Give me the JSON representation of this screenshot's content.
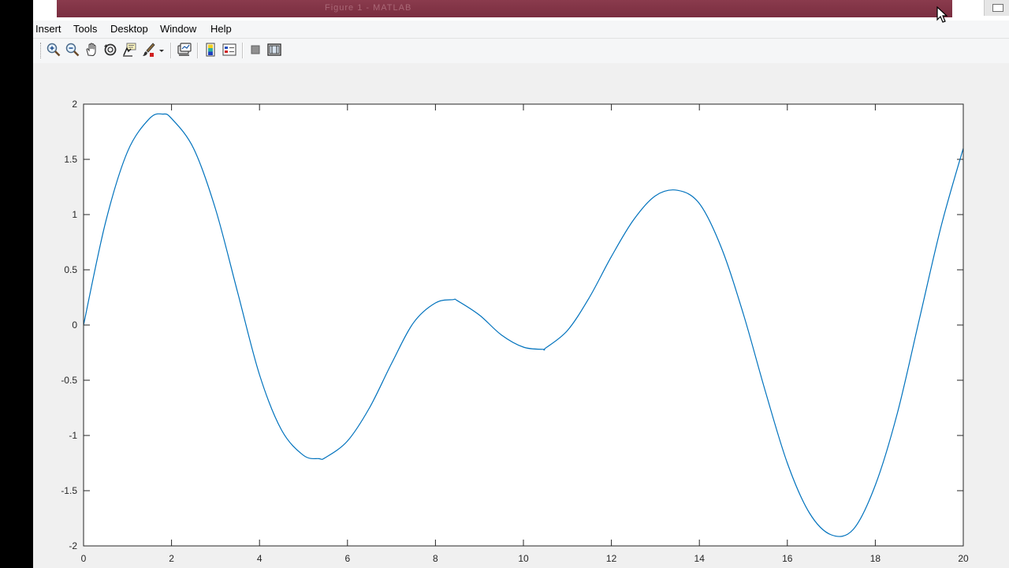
{
  "window": {
    "title": "Figure 1 - MATLAB"
  },
  "menu": {
    "items": [
      {
        "label": "Insert"
      },
      {
        "label": "Tools"
      },
      {
        "label": "Desktop"
      },
      {
        "label": "Window"
      },
      {
        "label": "Help"
      }
    ]
  },
  "toolbar": {
    "icons": [
      "zoom-in-icon",
      "zoom-out-icon",
      "pan-hand-icon",
      "rotate-3d-icon",
      "data-cursor-icon",
      "brush-icon",
      "brush-dropdown-icon",
      "link-plot-icon",
      "colorbar-icon",
      "legend-icon",
      "hide-plot-tools-icon",
      "show-plot-tools-icon"
    ]
  },
  "colors": {
    "line": "#0072bd",
    "titlebar": "#7f3346",
    "figure_bg": "#f0f0f0",
    "axes_bg": "#ffffff"
  },
  "chart_data": {
    "type": "line",
    "title": "",
    "xlabel": "",
    "ylabel": "",
    "xlim": [
      0,
      20
    ],
    "ylim": [
      -2,
      2
    ],
    "xticks": [
      0,
      2,
      4,
      6,
      8,
      10,
      12,
      14,
      16,
      18,
      20
    ],
    "yticks": [
      -2,
      -1.5,
      -1,
      -0.5,
      0,
      0.5,
      1,
      1.5,
      2
    ],
    "xtick_labels": [
      "0",
      "2",
      "4",
      "6",
      "8",
      "10",
      "12",
      "14",
      "16",
      "18",
      "20"
    ],
    "ytick_labels": [
      "-2",
      "-1.5",
      "-1",
      "-0.5",
      "0",
      "0.5",
      "1",
      "1.5",
      "2"
    ],
    "grid": false,
    "series": [
      {
        "x": [
          0,
          0.5,
          1,
          1.5,
          1.8,
          2,
          2.5,
          3,
          3.5,
          4,
          4.5,
          5,
          5.35,
          5.5,
          6,
          6.5,
          7,
          7.5,
          8,
          8.4,
          8.5,
          9,
          9.5,
          10,
          10.45,
          10.5,
          11,
          11.5,
          12,
          12.5,
          13,
          13.5,
          14,
          14.5,
          15,
          15.5,
          16,
          16.5,
          17,
          17.5,
          18,
          18.5,
          19,
          19.5,
          20
        ],
        "y": [
          0,
          0.93,
          1.57,
          1.87,
          1.91,
          1.87,
          1.6,
          1.05,
          0.3,
          -0.45,
          -0.95,
          -1.18,
          -1.21,
          -1.2,
          -1.05,
          -0.75,
          -0.35,
          0.02,
          0.2,
          0.23,
          0.22,
          0.09,
          -0.09,
          -0.2,
          -0.22,
          -0.21,
          -0.05,
          0.25,
          0.62,
          0.95,
          1.17,
          1.22,
          1.1,
          0.7,
          0.1,
          -0.6,
          -1.25,
          -1.7,
          -1.9,
          -1.85,
          -1.45,
          -0.8,
          0.05,
          0.9,
          1.6
        ]
      }
    ]
  }
}
